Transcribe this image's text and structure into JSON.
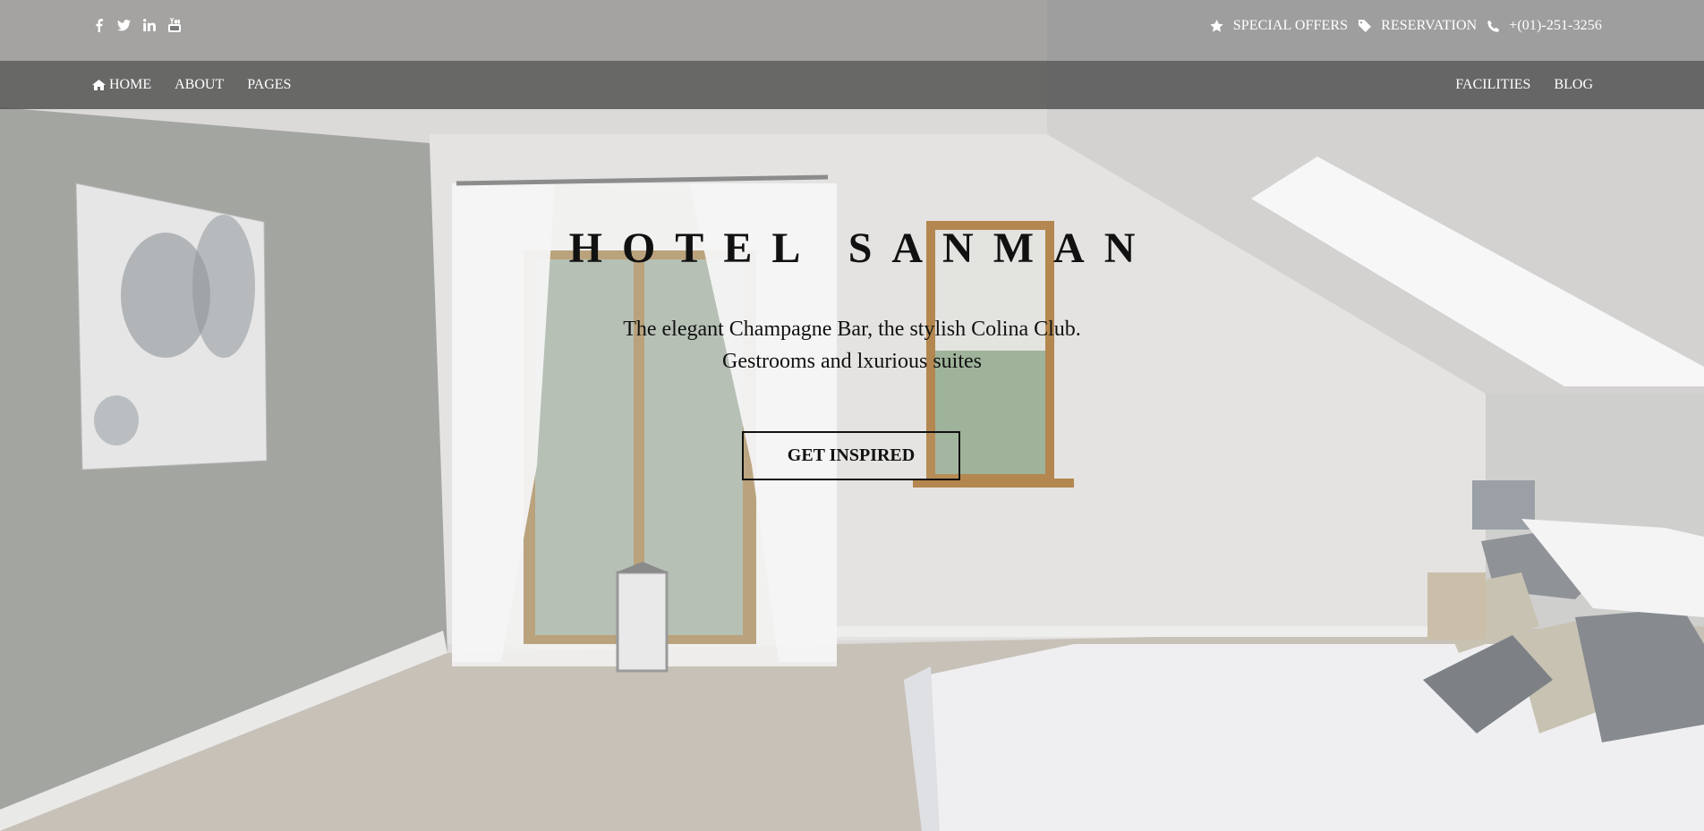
{
  "social": {
    "icons": [
      "facebook-icon",
      "twitter-icon",
      "linkedin-icon",
      "youtube-icon"
    ]
  },
  "contact": {
    "special_offers": "SPECIAL OFFERS",
    "reservation": "RESERVATION",
    "phone": "+(01)-251-3256"
  },
  "nav": {
    "home": "HOME",
    "about": "ABOUT",
    "pages": "PAGES",
    "facilities": "FACILITIES",
    "blog": "BLOG"
  },
  "hero": {
    "title": "HOTEL SANMAN",
    "subtitle_line1": "The elegant Champagne Bar, the stylish Colina Club.",
    "subtitle_line2": "Gestrooms and lxurious suites",
    "cta": "GET INSPIRED"
  },
  "colors": {
    "topbar": "#5f5f5f",
    "navbar": "#4e4e4e",
    "text_dark": "#111111",
    "text_light": "#ffffff"
  }
}
